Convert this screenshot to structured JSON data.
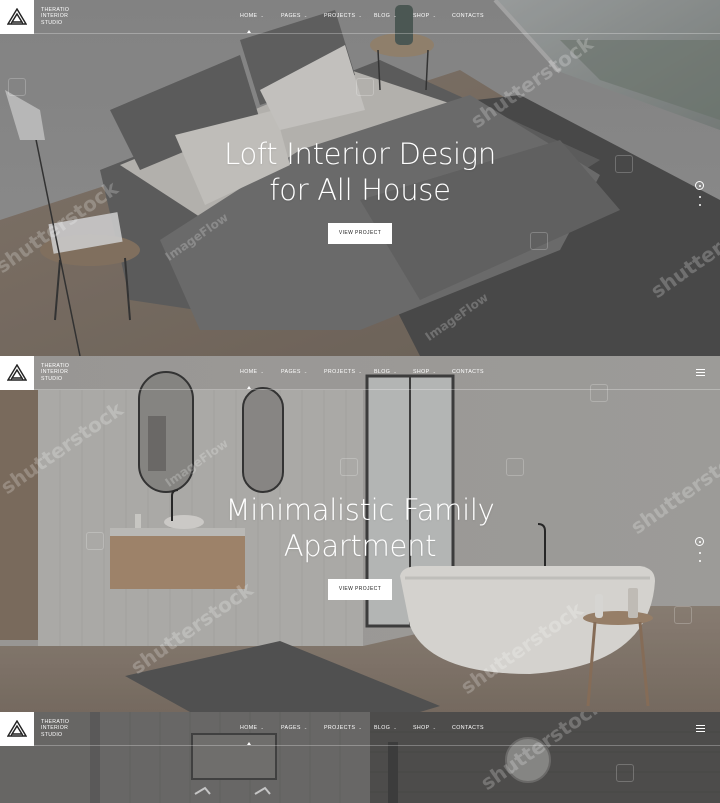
{
  "brand": {
    "line1": "THERATIO",
    "line2": "INTERIOR",
    "line3": "STUDIO"
  },
  "nav": {
    "home": "HOME",
    "pages": "PAGES",
    "projects": "PROJECTS",
    "blog": "BLOG",
    "shop": "SHOP",
    "contacts": "CONTACTS"
  },
  "slides": [
    {
      "title_line1": "Loft Interior Design",
      "title_line2": "for All House",
      "button": "VIEW PROJECT"
    },
    {
      "title_line1": "Minimalistic Family",
      "title_line2": "Apartment",
      "button": "VIEW PROJECT"
    }
  ],
  "watermarks": {
    "shutterstock": "shutterstock",
    "imageflow": "ImageFlow"
  },
  "colors": {
    "overlay": "#5b5b5b",
    "accent": "#ffffff",
    "button_text": "#222222"
  },
  "icons": [
    "logo-icon",
    "caret-down-icon",
    "menu-icon",
    "pager-ring-icon",
    "pager-dot-icon"
  ]
}
